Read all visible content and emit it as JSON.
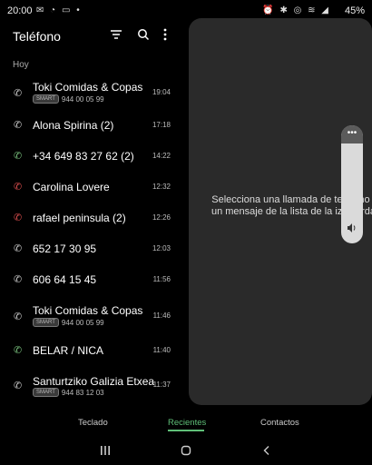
{
  "status": {
    "time": "20:00",
    "battery": "45%"
  },
  "app": {
    "title": "Teléfono"
  },
  "icons": {
    "filter": "filter-icon",
    "search": "search-icon",
    "more": "more-vert-icon"
  },
  "section": "Hoy",
  "calls": [
    {
      "name": "Toki Comidas & Copas",
      "badge": "SMART",
      "number": "944 00 05 99",
      "time": "19:04",
      "type": "incoming"
    },
    {
      "name": "Alona Spirina (2)",
      "time": "17:18",
      "type": "incoming"
    },
    {
      "name": "+34 649 83 27 62 (2)",
      "time": "14:22",
      "type": "outgoing"
    },
    {
      "name": "Carolina Lovere",
      "time": "12:32",
      "type": "missed"
    },
    {
      "name": "rafael peninsula (2)",
      "time": "12:26",
      "type": "missed"
    },
    {
      "name": "652 17 30 95",
      "time": "12:03",
      "type": "incoming"
    },
    {
      "name": "606 64 15 45",
      "time": "11:56",
      "type": "incoming"
    },
    {
      "name": "Toki Comidas & Copas",
      "badge": "SMART",
      "number": "944 00 05 99",
      "time": "11:46",
      "type": "incoming"
    },
    {
      "name": "BELAR / NICA",
      "time": "11:40",
      "type": "outgoing"
    },
    {
      "name": "Santurtziko Galizia Etxea",
      "badge": "SMART",
      "number": "944 83 12 03",
      "time": "11:37",
      "type": "incoming"
    }
  ],
  "detail": {
    "empty_message": "Selecciona una llamada de teléfono o un mensaje de la lista de la izquierda."
  },
  "tabs": [
    {
      "label": "Teclado"
    },
    {
      "label": "Recientes",
      "active": true
    },
    {
      "label": "Contactos"
    }
  ],
  "volume": {
    "more_glyph": "•••"
  },
  "colors": {
    "accent": "#5fbf78",
    "missed": "#e05050",
    "panel": "#2a2a2a"
  }
}
